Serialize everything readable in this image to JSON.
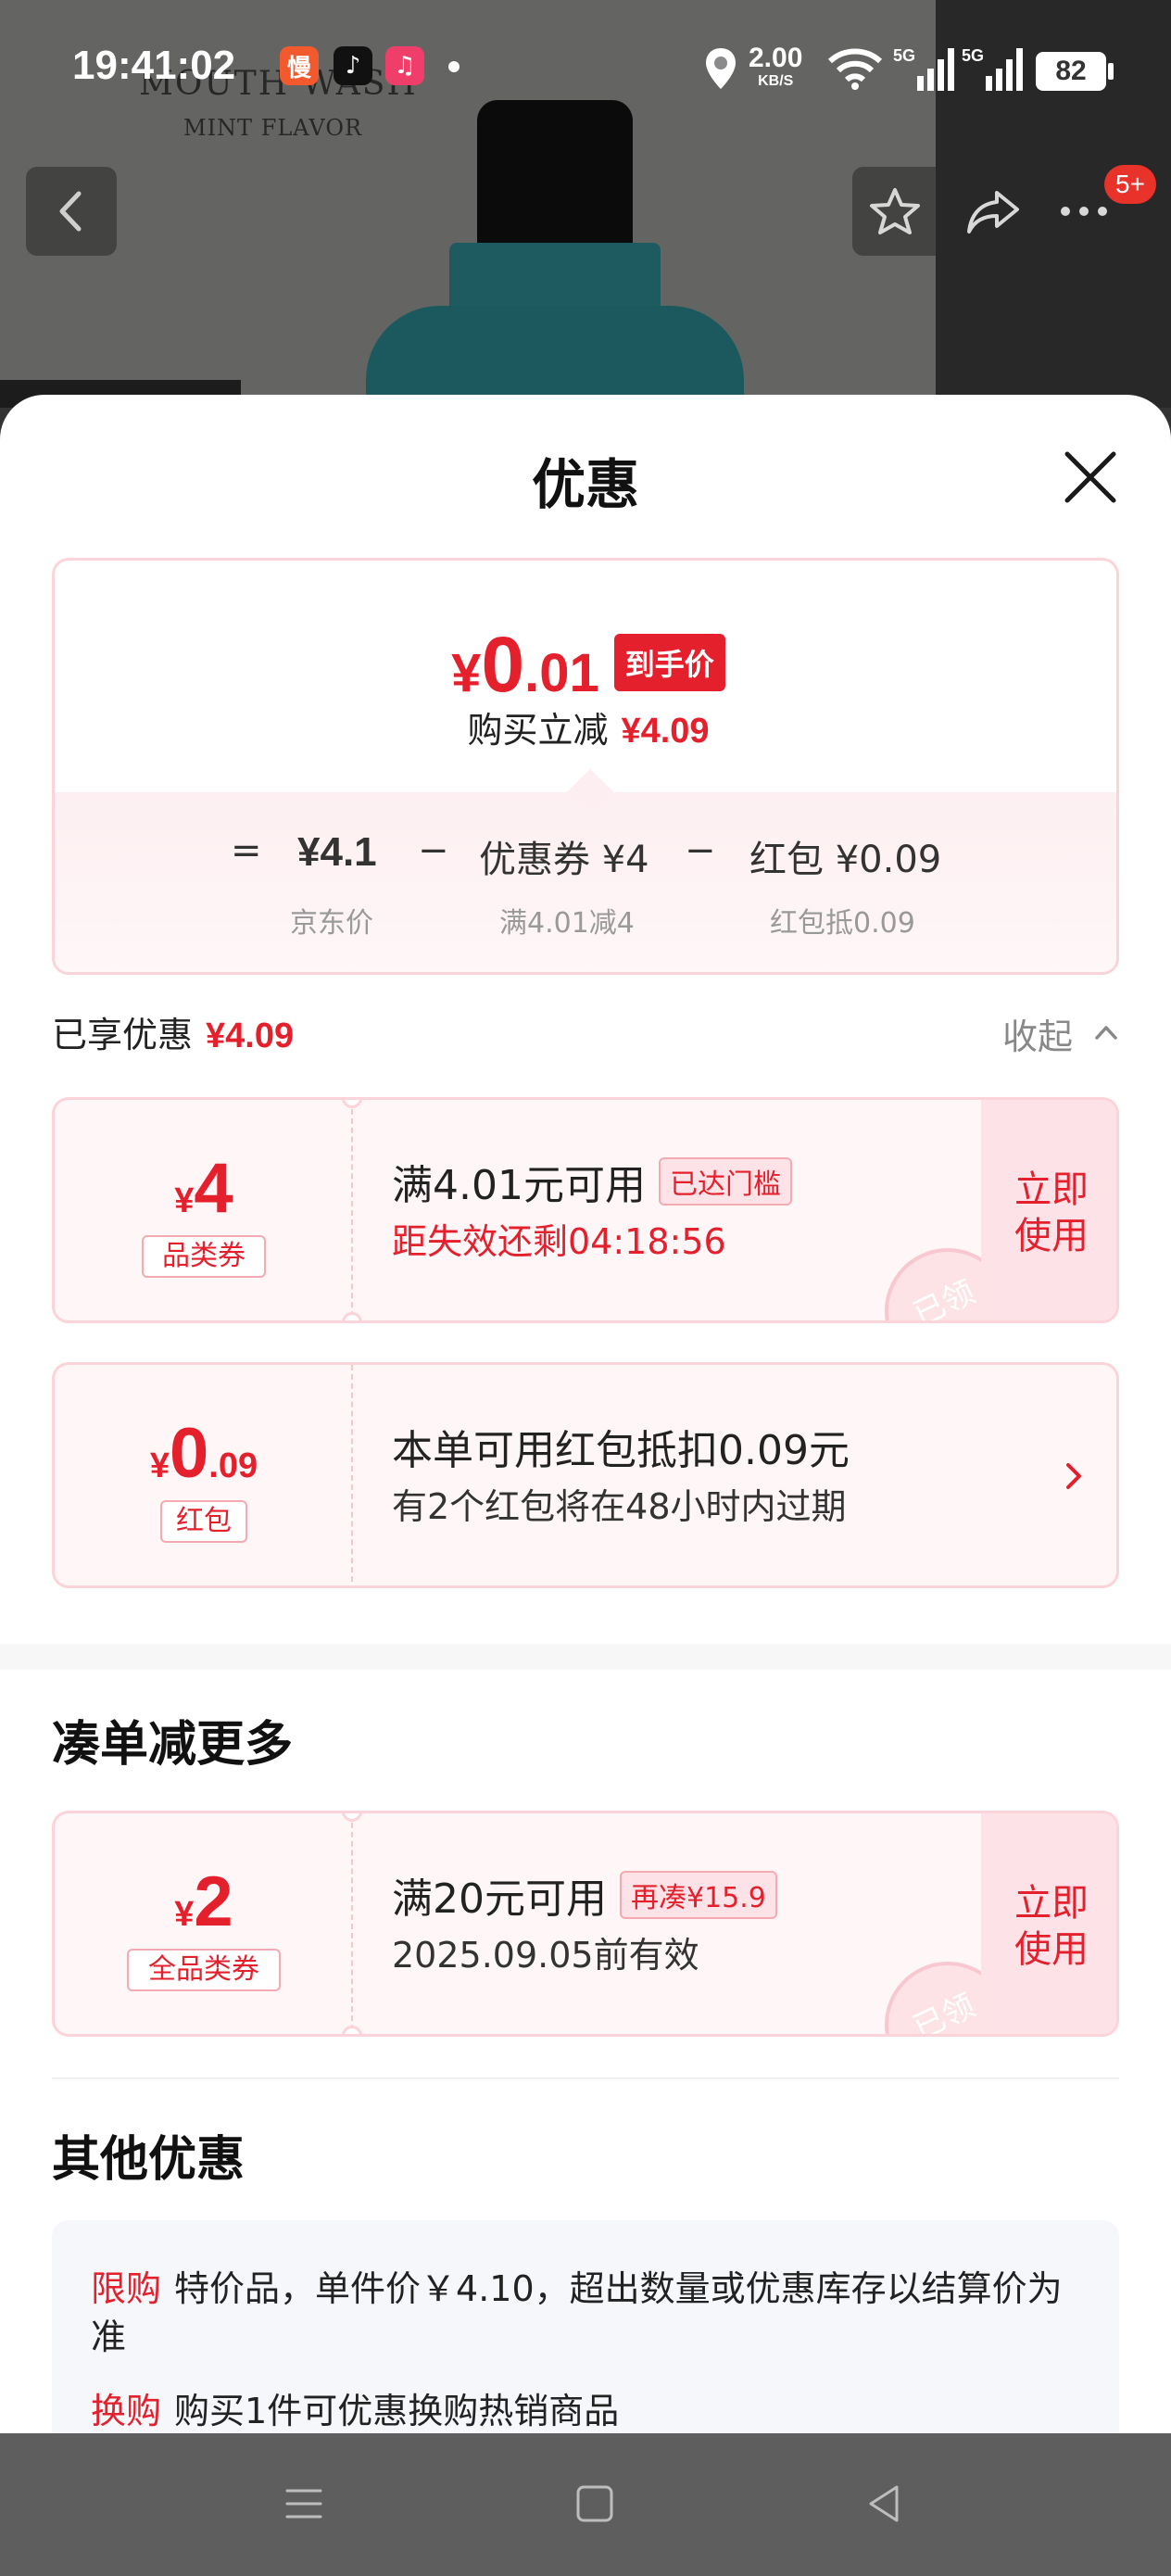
{
  "status_bar": {
    "time": "19:41:02",
    "app_icons": [
      "man-app-icon",
      "tiktok-icon",
      "music-icon"
    ],
    "app_icon_glyphs": [
      "慢",
      "♪",
      "♫"
    ],
    "net_speed_value": "2.00",
    "net_speed_unit": "KB/S",
    "signal_labels": [
      "5G",
      "5G"
    ],
    "battery": "82"
  },
  "background": {
    "brand_line1": "MOUTH WASH",
    "brand_line2": "MINT FLAVOR",
    "cart_badge": "5+"
  },
  "sheet": {
    "title": "优惠",
    "summary": {
      "price_yen": "¥",
      "price_int": "0",
      "price_dec": ".01",
      "price_tag": "到手价",
      "instant_label": "购买立减",
      "instant_value": "¥4.09",
      "formula": {
        "eq": "=",
        "jd_price": "¥4.1",
        "minus1": "−",
        "coupon": "优惠券 ¥4",
        "minus2": "−",
        "redpacket": "红包 ¥0.09",
        "jd_price_label": "京东价",
        "coupon_label": "满4.01减4",
        "redpacket_label": "红包抵0.09"
      }
    },
    "enjoyed_label": "已享优惠",
    "enjoyed_value": "¥4.09",
    "collapse_label": "收起",
    "coupons": [
      {
        "yen": "¥",
        "amount_int": "4",
        "amount_dec": "",
        "kind": "品类券",
        "main": "满4.01元可用",
        "tag": "已达门槛",
        "sub": "距失效还剩04:18:56",
        "use_line1": "立即",
        "use_line2": "使用",
        "stamp": "已领"
      },
      {
        "yen": "¥",
        "amount_int": "0",
        "amount_dec": ".09",
        "kind": "红包",
        "main": "本单可用红包抵扣0.09元",
        "sub": "有2个红包将在48小时内过期"
      }
    ],
    "more_title": "凑单减更多",
    "more_coupon": {
      "yen": "¥",
      "amount_int": "2",
      "kind": "全品类券",
      "main": "满20元可用",
      "tag": "再凑¥15.9",
      "sub": "2025.09.05前有效",
      "use_line1": "立即",
      "use_line2": "使用",
      "stamp": "已领"
    },
    "other_title": "其他优惠",
    "other_items": [
      {
        "tag": "限购",
        "text": "特价品，单件价￥4.10，超出数量或优惠库存以结算价为准"
      },
      {
        "tag": "换购",
        "text": "购买1件可优惠换购热销商品"
      }
    ]
  },
  "colors": {
    "accent_red": "#e4202d",
    "coupon_bg": "#fff6f7",
    "coupon_border": "#fbd3d8"
  }
}
